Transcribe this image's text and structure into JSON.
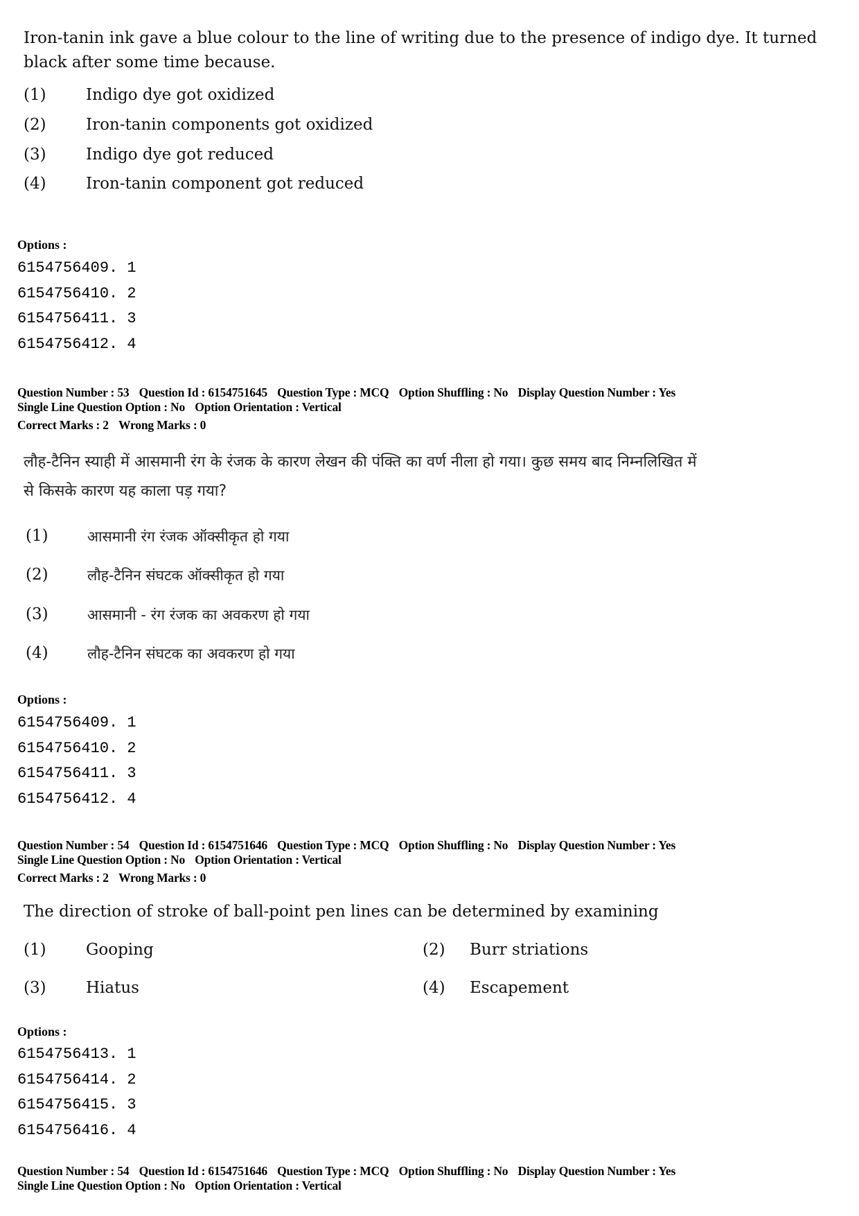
{
  "question_52_tail": {
    "text": "Iron-tanin ink gave a blue colour to the line of writing due to the presence of indigo dye. It turned black after some time because.",
    "choices": [
      {
        "num": "(1)",
        "text": "Indigo dye got oxidized"
      },
      {
        "num": "(2)",
        "text": "Iron-tanin components got oxidized"
      },
      {
        "num": "(3)",
        "text": "Indigo dye got reduced"
      },
      {
        "num": "(4)",
        "text": "Iron-tanin component got reduced"
      }
    ],
    "options_label": "Options :",
    "option_ids": [
      "6154756409. 1",
      "6154756410. 2",
      "6154756411. 3",
      "6154756412. 4"
    ]
  },
  "question_53": {
    "meta_line1": [
      "Question Number : 53",
      "Question Id : 6154751645",
      "Question Type : MCQ",
      "Option Shuffling : No",
      "Display Question Number : Yes"
    ],
    "meta_line2": [
      "Single Line Question Option : No",
      "Option Orientation : Vertical"
    ],
    "marks": [
      "Correct Marks : 2",
      "Wrong Marks : 0"
    ],
    "text_line1": "लौह-टैनिन स्याही में आसमानी रंग के रंजक के कारण लेखन की पंक्ति का वर्ण नीला हो गया। कुछ समय बाद निम्नलिखित में",
    "text_line2": "से किसके कारण यह काला पड़ गया?",
    "choices": [
      {
        "num": "(1)",
        "text": "आसमानी रंग रंजक ऑक्सीकृत हो गया"
      },
      {
        "num": "(2)",
        "text": "लौह-टैनिन संघटक ऑक्सीकृत हो गया"
      },
      {
        "num": "(3)",
        "text": "आसमानी - रंग रंजक का अवकरण हो गया"
      },
      {
        "num": "(4)",
        "text": "लौह-टैनिन संघटक का अवकरण हो गया"
      }
    ],
    "options_label": "Options :",
    "option_ids": [
      "6154756409. 1",
      "6154756410. 2",
      "6154756411. 3",
      "6154756412. 4"
    ]
  },
  "question_54": {
    "meta_line1": [
      "Question Number : 54",
      "Question Id : 6154751646",
      "Question Type : MCQ",
      "Option Shuffling : No",
      "Display Question Number : Yes"
    ],
    "meta_line2": [
      "Single Line Question Option : No",
      "Option Orientation : Vertical"
    ],
    "marks": [
      "Correct Marks : 2",
      "Wrong Marks : 0"
    ],
    "text": "The direction of stroke of ball-point pen lines can be determined by examining",
    "choices": [
      {
        "num": "(1)",
        "text": "Gooping"
      },
      {
        "num": "(2)",
        "text": "Burr striations"
      },
      {
        "num": "(3)",
        "text": "Hiatus"
      },
      {
        "num": "(4)",
        "text": "Escapement"
      }
    ],
    "options_label": "Options :",
    "option_ids": [
      "6154756413. 1",
      "6154756414. 2",
      "6154756415. 3",
      "6154756416. 4"
    ]
  },
  "question_54_hindi_header": {
    "meta_line1": [
      "Question Number : 54",
      "Question Id : 6154751646",
      "Question Type : MCQ",
      "Option Shuffling : No",
      "Display Question Number : Yes"
    ],
    "meta_line2": [
      "Single Line Question Option : No",
      "Option Orientation : Vertical"
    ]
  }
}
